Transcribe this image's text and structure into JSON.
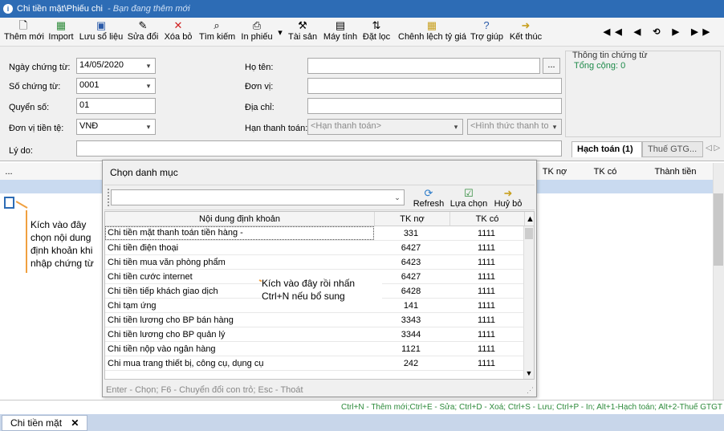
{
  "titlebar": {
    "title": "Chi tiền mặt\\Phiếu chi",
    "hint": "- Bạn đang thêm mới"
  },
  "toolbar": {
    "buttons": [
      {
        "label": "Thêm mới",
        "icon": "new-doc-icon"
      },
      {
        "label": "Import",
        "icon": "import-icon"
      },
      {
        "label": "Lưu sổ liệu",
        "icon": "save-icon"
      },
      {
        "label": "Sửa đổi",
        "icon": "edit-icon"
      },
      {
        "label": "Xóa bỏ",
        "icon": "delete-icon"
      },
      {
        "label": "Tìm kiếm",
        "icon": "search-icon"
      },
      {
        "label": "In phiếu",
        "icon": "print-icon"
      },
      {
        "label": "Tài sản",
        "icon": "tools-icon"
      },
      {
        "label": "Máy tính",
        "icon": "calculator-icon"
      },
      {
        "label": "Đặt lọc",
        "icon": "sort-filter-icon"
      },
      {
        "label": "Chênh lệch tỷ giá",
        "icon": "exchange-icon"
      },
      {
        "label": "Trợ giúp",
        "icon": "help-icon"
      },
      {
        "label": "Kết thúc",
        "icon": "exit-icon"
      }
    ],
    "nav": "◀◀ ◀ ⟲ ▶ ▶▶"
  },
  "form": {
    "ngay_label": "Ngày chứng từ:",
    "ngay_value": "14/05/2020",
    "so_label": "Số chứng từ:",
    "so_value": "0001",
    "quyen_label": "Quyển số:",
    "quyen_value": "01",
    "tien_label": "Đơn vị tiền tệ:",
    "tien_value": "VNĐ",
    "lydo_label": "Lý do:",
    "hoten_label": "Họ tên:",
    "hoten_value": "",
    "browse_label": "...",
    "donvi_label": "Đơn vị:",
    "diachi_label": "Địa chỉ:",
    "han_label": "Hạn thanh toán:",
    "han_value": "<Hạn thanh toán>",
    "hinhthuc_value": "<Hình thức thanh toán>"
  },
  "info": {
    "title": "Thông tin chứng từ",
    "total": "Tổng cộng: 0"
  },
  "tabs": [
    {
      "label": "Hạch toán (1)"
    },
    {
      "label": "Thuế GTG..."
    }
  ],
  "grid": {
    "headers": [
      "...",
      "TK nợ",
      "TK có",
      "Thành tiền"
    ]
  },
  "callout1": "Kích vào đây chọn nội dung định khoản khi nhập chứng từ",
  "callout2": "Kích vào đây rồi nhấn Ctrl+N nếu bổ sung",
  "popup": {
    "title": "Chọn danh mục",
    "refresh": "Refresh",
    "select": "Lựa chọn",
    "cancel": "Huỷ bỏ",
    "headers": [
      "Nội dung định khoản",
      "TK nợ",
      "TK có"
    ],
    "rows": [
      [
        "Chi tiền mặt thanh toán tiền hàng -",
        "331",
        "1111"
      ],
      [
        "Chi tiền điện thoại",
        "6427",
        "1111"
      ],
      [
        "Chi tiền mua văn phòng phẩm",
        "6423",
        "1111"
      ],
      [
        "Chi tiền cước internet",
        "6427",
        "1111"
      ],
      [
        "Chi tiền tiếp khách giao dịch",
        "6428",
        "1111"
      ],
      [
        "Chi tạm ứng",
        "141",
        "1111"
      ],
      [
        "Chi tiền lương cho BP bán hàng",
        "3343",
        "1111"
      ],
      [
        "Chi tiền lương cho BP quản lý",
        "3344",
        "1111"
      ],
      [
        "Chi tiền nộp vào ngân hàng",
        "1121",
        "1111"
      ],
      [
        "Chi mua trang thiết bị, công cụ, dụng cụ",
        "242",
        "1111"
      ]
    ],
    "footer": "Enter - Chọn; F6 - Chuyển đổi con trỏ; Esc - Thoát"
  },
  "shortcuts": "Ctrl+N - Thêm mới;Ctrl+E - Sửa; Ctrl+D - Xoá; Ctrl+S - Lưu; Ctrl+P - In; Alt+1-Hạch toán; Alt+2-Thuế GTGT",
  "bottomtab": {
    "label": "Chi tiền mặt",
    "close": "✕"
  }
}
